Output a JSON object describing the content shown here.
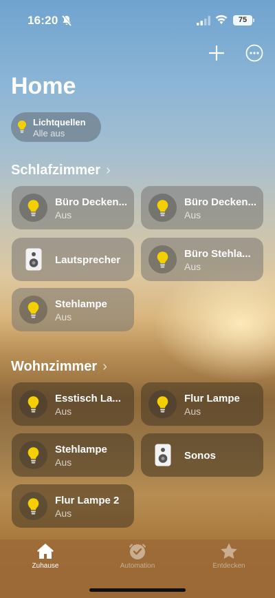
{
  "status_bar": {
    "time": "16:20",
    "battery": "75"
  },
  "header": {
    "title": "Home"
  },
  "summary_chip": {
    "title": "Lichtquellen",
    "subtitle": "Alle aus"
  },
  "rooms": [
    {
      "name": "Schlafzimmer",
      "chevron": "›",
      "accessories": [
        {
          "name": "Büro Decken...",
          "state": "Aus",
          "icon": "bulb-icon"
        },
        {
          "name": "Büro Decken...",
          "state": "Aus",
          "icon": "bulb-icon"
        },
        {
          "name": "Lautsprecher",
          "state": "",
          "icon": "speaker-icon"
        },
        {
          "name": "Büro Stehla...",
          "state": "Aus",
          "icon": "bulb-icon"
        },
        {
          "name": "Stehlampe",
          "state": "Aus",
          "icon": "bulb-icon"
        }
      ]
    },
    {
      "name": "Wohnzimmer",
      "chevron": "›",
      "accessories": [
        {
          "name": "Esstisch La...",
          "state": "Aus",
          "icon": "bulb-icon"
        },
        {
          "name": "Flur Lampe",
          "state": "Aus",
          "icon": "bulb-icon"
        },
        {
          "name": "Stehlampe",
          "state": "Aus",
          "icon": "bulb-icon"
        },
        {
          "name": "Sonos",
          "state": "",
          "icon": "speaker-icon"
        },
        {
          "name": "Flur Lampe 2",
          "state": "Aus",
          "icon": "bulb-icon"
        }
      ]
    }
  ],
  "tab_bar": {
    "tabs": [
      {
        "label": "Zuhause",
        "icon": "house-icon",
        "active": true
      },
      {
        "label": "Automation",
        "icon": "clock-check-icon",
        "active": false
      },
      {
        "label": "Entdecken",
        "icon": "star-icon",
        "active": false
      }
    ]
  },
  "colors": {
    "bulb": "#f5d000",
    "tab_bar": "#9b6937"
  }
}
